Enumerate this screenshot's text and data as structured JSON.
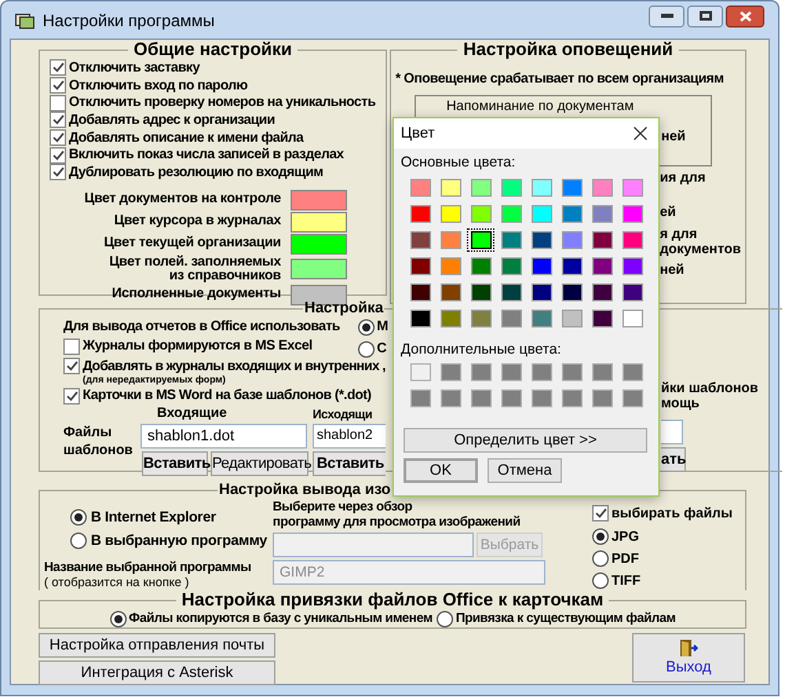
{
  "window": {
    "title": "Настройки программы"
  },
  "general": {
    "title": "Общие настройки",
    "options": [
      {
        "label": "Отключить заставку",
        "checked": true
      },
      {
        "label": "Отключить вход по паролю",
        "checked": true
      },
      {
        "label": "Отключить проверку номеров на уникальность",
        "checked": false
      },
      {
        "label": "Добавлять адрес к организации",
        "checked": true
      },
      {
        "label": "Добавлять описание к имени файла",
        "checked": true
      },
      {
        "label": "Включить показ числа записей в разделах",
        "checked": true
      },
      {
        "label": "Дублировать резолюцию по входящим",
        "checked": true
      }
    ],
    "colors": [
      {
        "lines": [
          "Цвет документов на контроле"
        ],
        "color": "#ff8080"
      },
      {
        "lines": [
          "Цвет курсора в журналах"
        ],
        "color": "#ffff80"
      },
      {
        "lines": [
          "Цвет текущей организации"
        ],
        "color": "#00ff00"
      },
      {
        "lines": [
          "Цвет полей. заполняемых",
          "из справочников"
        ],
        "color": "#80ff80"
      },
      {
        "lines": [
          "Исполненные документы"
        ],
        "color": "#c0c0c0"
      }
    ]
  },
  "notifications": {
    "title": "Настройка оповещений",
    "note": "* Оповещение срабатывает по всем организациям",
    "reminder_box": {
      "title": "Напоминание по документам",
      "fragment": "ней"
    },
    "fragments": [
      "ия для",
      "ей",
      "я для",
      "документов",
      "ней"
    ]
  },
  "office": {
    "title": "Настройка",
    "output_label": "Для вывода отчетов в Office использовать",
    "output_options": [
      {
        "label": "М",
        "selected": true
      },
      {
        "label": "С",
        "selected": false
      }
    ],
    "options": [
      {
        "label": "Журналы формируются в MS Excel",
        "checked": false
      },
      {
        "label": "Добавлять в журналы входящих и внутренних ,",
        "checked": true,
        "note": "(для нередактируемых форм)"
      },
      {
        "label": "Карточки в MS Word на базе шаблонов (*.dot)",
        "checked": true
      }
    ],
    "templates_label": "Файлы шаблонов",
    "incoming": {
      "title": "Входящие",
      "value": "shablon1.dot",
      "buttons": [
        "Вставить",
        "Редактировать"
      ]
    },
    "outgoing": {
      "title": "Исходящи",
      "value": "shablon2",
      "buttons": [
        "Вставить"
      ]
    },
    "fragments": [
      "йки шаблонов",
      "мощь"
    ],
    "button_fragment": "ать"
  },
  "images": {
    "title": "Настройка вывода изо",
    "targets": [
      {
        "label": "В Internet Explorer",
        "selected": true
      },
      {
        "label": "В выбранную программу",
        "selected": false
      }
    ],
    "browse_hint": [
      "Выберите через обзор",
      "программу для просмотра изображений"
    ],
    "browse_button": {
      "label": "Выбрать",
      "disabled": true
    },
    "program_name_label": "Название выбранной программы",
    "program_name_hint": "( отобразится на кнопке )",
    "program_name": {
      "value": "GIMP2",
      "disabled": true
    },
    "choose_files": {
      "label": "выбирать файлы",
      "checked": true
    },
    "formats": [
      {
        "label": "JPG",
        "selected": true
      },
      {
        "label": "PDF",
        "selected": false
      },
      {
        "label": "TIFF",
        "selected": false
      }
    ]
  },
  "binding": {
    "title": "Настройка привязки файлов Office к карточкам",
    "options": [
      {
        "label": "Файлы копируются в базу с уникальным именем",
        "selected": true
      },
      {
        "label": "Привязка к существующим файлам",
        "selected": false
      }
    ]
  },
  "buttons": [
    "Настройка отправления почты",
    "Интеграция с Asterisk"
  ],
  "exit": "Выход",
  "color_dialog": {
    "title": "Цвет",
    "basic_label": "Основные цвета:",
    "basic_colors": [
      {
        "color": "#ff8080",
        "selected": false
      },
      {
        "color": "#ffff80",
        "selected": false
      },
      {
        "color": "#80ff80",
        "selected": false
      },
      {
        "color": "#00ff80",
        "selected": false
      },
      {
        "color": "#80ffff",
        "selected": false
      },
      {
        "color": "#0080ff",
        "selected": false
      },
      {
        "color": "#ff80c0",
        "selected": false
      },
      {
        "color": "#ff80ff",
        "selected": false
      },
      {
        "color": "#ff0000",
        "selected": false
      },
      {
        "color": "#ffff00",
        "selected": false
      },
      {
        "color": "#80ff00",
        "selected": false
      },
      {
        "color": "#00ff40",
        "selected": false
      },
      {
        "color": "#00ffff",
        "selected": false
      },
      {
        "color": "#0080c0",
        "selected": false
      },
      {
        "color": "#8080c0",
        "selected": false
      },
      {
        "color": "#ff00ff",
        "selected": false
      },
      {
        "color": "#804040",
        "selected": false
      },
      {
        "color": "#ff8040",
        "selected": false
      },
      {
        "color": "#00ff00",
        "selected": true
      },
      {
        "color": "#008080",
        "selected": false
      },
      {
        "color": "#004080",
        "selected": false
      },
      {
        "color": "#8080ff",
        "selected": false
      },
      {
        "color": "#800040",
        "selected": false
      },
      {
        "color": "#ff0080",
        "selected": false
      },
      {
        "color": "#800000",
        "selected": false
      },
      {
        "color": "#ff8000",
        "selected": false
      },
      {
        "color": "#008000",
        "selected": false
      },
      {
        "color": "#008040",
        "selected": false
      },
      {
        "color": "#0000ff",
        "selected": false
      },
      {
        "color": "#0000a0",
        "selected": false
      },
      {
        "color": "#800080",
        "selected": false
      },
      {
        "color": "#8000ff",
        "selected": false
      },
      {
        "color": "#400000",
        "selected": false
      },
      {
        "color": "#804000",
        "selected": false
      },
      {
        "color": "#004000",
        "selected": false
      },
      {
        "color": "#004040",
        "selected": false
      },
      {
        "color": "#000080",
        "selected": false
      },
      {
        "color": "#000040",
        "selected": false
      },
      {
        "color": "#400040",
        "selected": false
      },
      {
        "color": "#400080",
        "selected": false
      },
      {
        "color": "#000000",
        "selected": false
      },
      {
        "color": "#808000",
        "selected": false
      },
      {
        "color": "#808040",
        "selected": false
      },
      {
        "color": "#808080",
        "selected": false
      },
      {
        "color": "#408080",
        "selected": false
      },
      {
        "color": "#c0c0c0",
        "selected": false
      },
      {
        "color": "#400040",
        "selected": false
      },
      {
        "color": "#ffffff",
        "selected": false
      }
    ],
    "custom_label": "Дополнительные цвета:",
    "custom_colors": [
      {
        "color": "#f0f0f0"
      },
      {
        "color": "#808080"
      },
      {
        "color": "#808080"
      },
      {
        "color": "#808080"
      },
      {
        "color": "#808080"
      },
      {
        "color": "#808080"
      },
      {
        "color": "#808080"
      },
      {
        "color": "#808080"
      },
      {
        "color": "#808080"
      },
      {
        "color": "#808080"
      },
      {
        "color": "#808080"
      },
      {
        "color": "#808080"
      },
      {
        "color": "#808080"
      },
      {
        "color": "#808080"
      },
      {
        "color": "#808080"
      },
      {
        "color": "#808080"
      }
    ],
    "define_button": "Определить цвет >>",
    "ok": "OK",
    "cancel": "Отмена"
  }
}
